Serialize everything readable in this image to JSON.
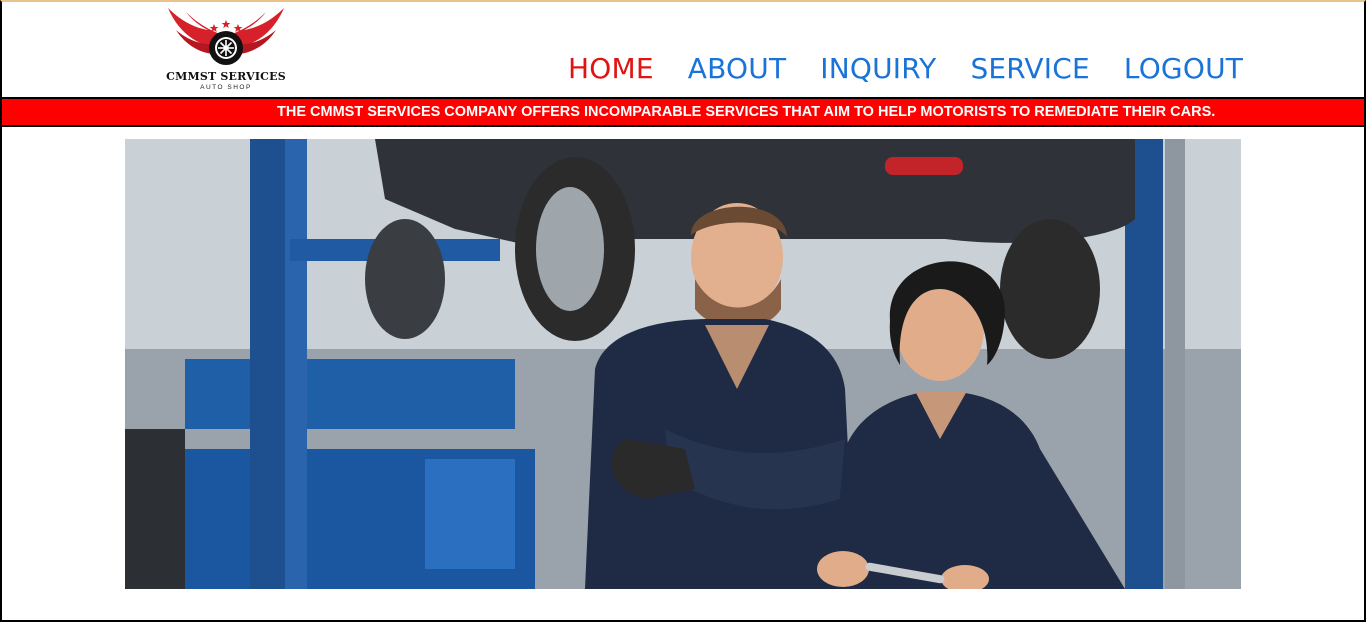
{
  "brand": {
    "name": "CMMST SERVICES",
    "tagline": "AUTO SHOP",
    "logo_colors": {
      "wings": "#d6202a",
      "wheel": "#111111",
      "stars": "#d6202a"
    }
  },
  "nav": {
    "items": [
      {
        "label": "HOME",
        "active": true
      },
      {
        "label": "ABOUT",
        "active": false
      },
      {
        "label": "INQUIRY",
        "active": false
      },
      {
        "label": "SERVICE",
        "active": false
      },
      {
        "label": "LOGOUT",
        "active": false
      }
    ],
    "colors": {
      "active": "#e11414",
      "default": "#1a73d9"
    }
  },
  "ticker": {
    "text": "THE CMMST SERVICES COMPANY OFFERS INCOMPARABLE SERVICES THAT AIM TO HELP MOTORISTS TO REMEDIATE THEIR CARS.",
    "background": "#ff0000"
  },
  "hero": {
    "image_subject": "mechanics-in-garage"
  }
}
